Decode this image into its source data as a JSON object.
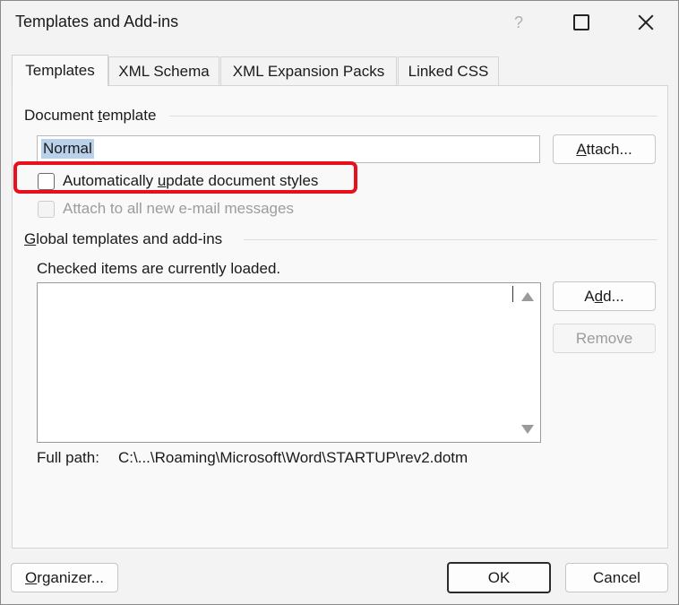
{
  "window": {
    "title": "Templates and Add-ins",
    "help_label": "?"
  },
  "tabs": [
    {
      "label": "Templates",
      "active": true
    },
    {
      "label": "XML Schema",
      "active": false
    },
    {
      "label": "XML Expansion Packs",
      "active": false
    },
    {
      "label": "Linked CSS",
      "active": false
    }
  ],
  "document_template": {
    "group_label_pre": "Document ",
    "group_label_key": "t",
    "group_label_post": "emplate",
    "value": "Normal",
    "attach_pre": "",
    "attach_key": "A",
    "attach_post": "ttach..."
  },
  "options": {
    "auto_update_pre": "Automatically ",
    "auto_update_key": "u",
    "auto_update_post": "pdate document styles",
    "auto_update_checked": false,
    "attach_email_label": "Attach to all new e-mail messages",
    "attach_email_enabled": false
  },
  "global_templates": {
    "group_label_key": "G",
    "group_label_post": "lobal templates and add-ins",
    "hint": "Checked items are currently loaded.",
    "items": [],
    "add_pre": "A",
    "add_key": "d",
    "add_post": "d...",
    "remove_label": "Remove",
    "full_path_label": "Full path:",
    "full_path_value": "C:\\...\\Roaming\\Microsoft\\Word\\STARTUP\\rev2.dotm"
  },
  "footer": {
    "organizer_key": "O",
    "organizer_post": "rganizer...",
    "ok_label": "OK",
    "cancel_label": "Cancel"
  },
  "colors": {
    "highlight": "#e8101d",
    "selection": "#b9d1ea"
  }
}
